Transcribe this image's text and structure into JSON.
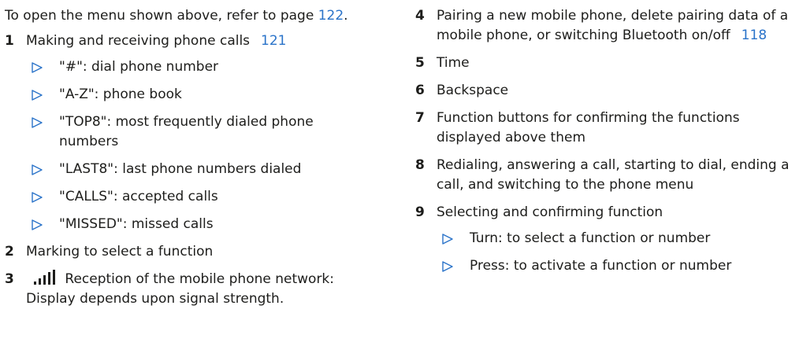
{
  "left": {
    "intro": {
      "text": "To open the menu shown above, refer to page",
      "link": "122",
      "end": "."
    },
    "items": [
      {
        "num": "1",
        "text": "Making and receiving phone calls",
        "ref": "121",
        "subs": [
          "\"#\": dial phone number",
          "\"A-Z\": phone book",
          "\"TOP8\": most frequently dialed phone numbers",
          "\"LAST8\": last phone numbers dialed",
          "\"CALLS\": accepted calls",
          "\"MISSED\": missed calls"
        ]
      },
      {
        "num": "2",
        "text": "Marking to select a function"
      },
      {
        "num": "3",
        "icon": "signal-strength-icon",
        "text": "Reception of the mobile phone network: Display depends upon signal strength."
      }
    ]
  },
  "right": {
    "items": [
      {
        "num": "4",
        "text": "Pairing a new mobile phone, delete pairing data of a mobile phone, or switching Bluetooth on/off",
        "ref": "118"
      },
      {
        "num": "5",
        "text": "Time"
      },
      {
        "num": "6",
        "text": "Backspace"
      },
      {
        "num": "7",
        "text": "Function buttons for confirming the functions displayed above them"
      },
      {
        "num": "8",
        "text": "Redialing, answering a call, starting to dial, ending a call, and switching to the phone menu"
      },
      {
        "num": "9",
        "text": "Selecting and confirming function",
        "subs": [
          "Turn: to select a function or number",
          "Press: to activate a function or number"
        ]
      }
    ]
  },
  "colors": {
    "text": "#1d1d1b",
    "link": "#2a73c9",
    "bullet": "#2a73c9"
  }
}
